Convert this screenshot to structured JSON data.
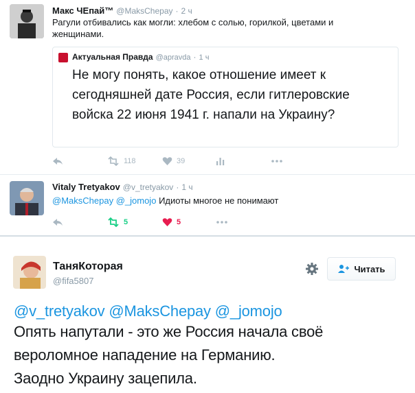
{
  "tweet1": {
    "name": "Макс ЧЕпай™",
    "handle": "@MaksChepay",
    "time": "2 ч",
    "text": "Рагули отбивались как могли: хлебом с солью, горилкой, цветами и женщинами.",
    "quote": {
      "name": "Актуальная Правда",
      "handle": "@apravda",
      "time": "1 ч",
      "text": "Не могу понять, какое отношение имеет к сегодняшней дате Россия, если гитлеровские войска 22 июня 1941 г. напали на Украину?"
    },
    "retweets": "118",
    "likes": "39"
  },
  "tweet2": {
    "name": "Vitaly Tretyakov",
    "handle": "@v_tretyakov",
    "time": "1 ч",
    "mention1": "@MaksChepay",
    "mention2": "@_jomojo",
    "text": "Идиоты многое не понимают",
    "retweets": "5",
    "likes": "5"
  },
  "tweet3": {
    "name": "ТаняКоторая",
    "handle": "@fifa5807",
    "follow_label": "Читать",
    "mentions": "@v_tretyakov @MaksChepay @_jomojo",
    "text_line1": "Опять напутали - это же Россия начала своё",
    "text_line2": "вероломное нападение на Германию.",
    "text_line3": "Заодно Украину зацепила."
  },
  "colors": {
    "link": "#1b95e0",
    "retweet_active": "#19cf86",
    "like_active": "#e81c4f",
    "muted": "#8899a6"
  }
}
